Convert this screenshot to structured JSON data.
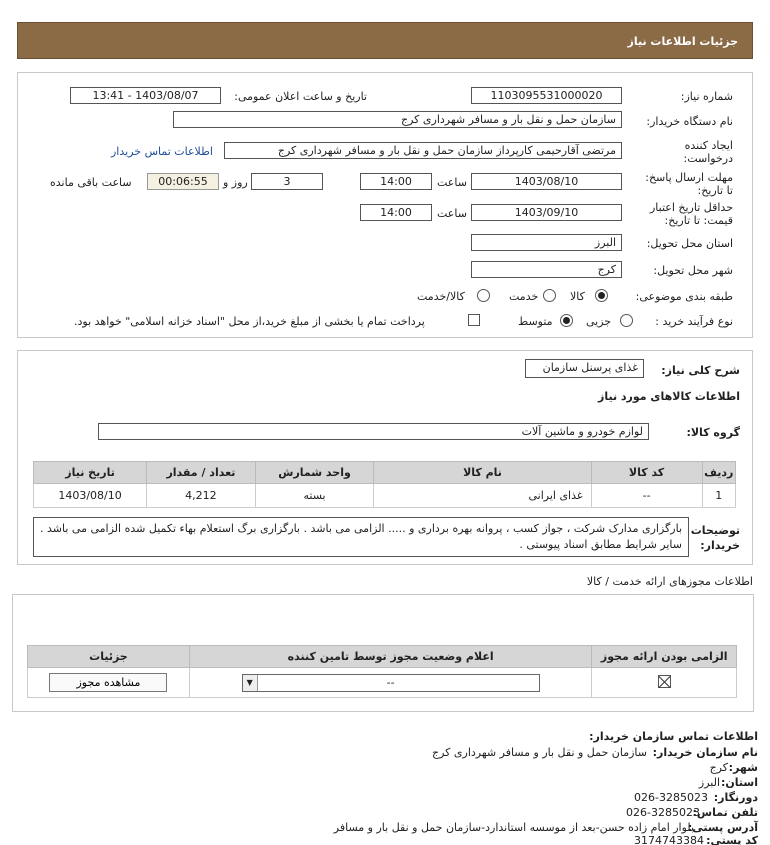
{
  "header": {
    "title": "جزئیات اطلاعات نیاز"
  },
  "form": {
    "need_number_label": "شماره نیاز:",
    "need_number": "1103095531000020",
    "announce_label": "تاریخ و ساعت اعلان عمومی:",
    "announce_value": "1403/08/07 - 13:41",
    "buyer_org_label": "نام دستگاه خریدار:",
    "buyer_org": "سازمان حمل و نقل بار و مسافر شهرداری کرج",
    "creator_label_1": "ایجاد کننده",
    "creator_label_2": "درخواست:",
    "creator": "مرتضی آقارحیمی کارپرداز سازمان حمل و نقل بار و مسافر شهرداری کرج",
    "contact_link": "اطلاعات تماس خریدار",
    "deadline_label_1": "مهلت ارسال پاسخ:",
    "deadline_label_2": "تا تاریخ:",
    "deadline_date": "1403/08/10",
    "time_label": "ساعت",
    "deadline_time": "14:00",
    "days_value": "3",
    "days_label": "روز و",
    "remaining_time": "00:06:55",
    "remaining_label": "ساعت باقی مانده",
    "validity_label_1": "حداقل تاریخ اعتبار",
    "validity_label_2": "قیمت: تا تاریخ:",
    "validity_date": "1403/09/10",
    "validity_time": "14:00",
    "province_label": "استان محل تحویل:",
    "province": "البرز",
    "city_label": "شهر محل تحویل:",
    "city": "کرج",
    "category_label": "طبقه بندی موضوعی:",
    "category_options": [
      "کالا",
      "خدمت",
      "کالا/خدمت"
    ],
    "category_selected": "کالا",
    "process_label": "نوع فرآیند خرید :",
    "process_options": [
      "جزیی",
      "متوسط"
    ],
    "process_selected": "متوسط",
    "payment_note": "پرداخت تمام یا بخشی از مبلغ خرید،از محل \"اسناد خزانه اسلامی\" خواهد بود."
  },
  "summary": {
    "desc_label": "شرح کلی نیاز:",
    "desc": "غذای پرسنل سازمان",
    "goods_title": "اطلاعات کالاهای مورد نیاز",
    "group_label": "گروه کالا:",
    "group": "لوازم خودرو و ماشین آلات",
    "table_headers": [
      "ردیف",
      "کد کالا",
      "نام کالا",
      "واحد شمارش",
      "تعداد / مقدار",
      "تاریخ نیاز"
    ],
    "table_rows": [
      {
        "row": "1",
        "code": "--",
        "name": "غذای ایرانی",
        "unit": "بسته",
        "qty": "4,212",
        "date": "1403/08/10"
      }
    ],
    "buyer_notes_label_1": "توضیحات",
    "buyer_notes_label_2": "خریدار:",
    "buyer_notes": "بارگزاری مدارک شرکت ، جواز کسب ، پروانه بهره برداری و ..... الزامی می باشد . بارگزاری برگ استعلام بهاء تکمیل شده الزامی می باشد . سایر شرایط مطابق اسناد پیوستی ."
  },
  "permits": {
    "title": "اطلاعات مجوزهای ارائه خدمت / کالا",
    "headers": [
      "الزامی بودن ارائه مجوز",
      "اعلام وضعیت مجوز توسط تامین کننده",
      "جزئیات"
    ],
    "select_value": "--",
    "view_button": "مشاهده مجوز"
  },
  "contact": {
    "title": "اطلاعات تماس سازمان خریدار:",
    "org_label": "نام سازمان خریدار:",
    "org": "سازمان حمل و نقل بار و مسافر شهرداری کرج",
    "city_label": "شهر:",
    "city": "کرج",
    "province_label": "استان:",
    "province": "البرز",
    "fax_label": "دورنگار:",
    "fax": "026-3285023",
    "phone_label": "تلفن تماس:",
    "phone": "026-3285023",
    "address_label": "آدرس پستی:",
    "address": "بلوار امام زاده حسن-بعد از موسسه استاندارد-سازمان حمل و نقل بار و مسافر",
    "postal_label": "کد پستی:",
    "postal": "3174743384"
  }
}
